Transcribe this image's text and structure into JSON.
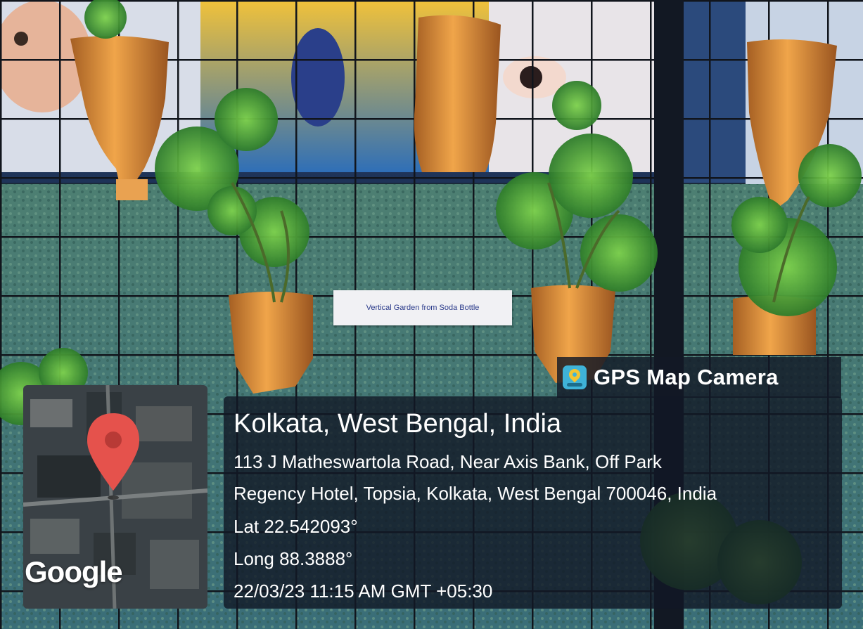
{
  "photo": {
    "description_icon": "vertical-garden-photo",
    "sign_text": "Vertical Garden from Soda Bottle"
  },
  "gps_overlay": {
    "app_name": "GPS Map Camera",
    "app_icon": "map-pin-icon",
    "location_title": "Kolkata, West Bengal, India",
    "address_line_1": "113 J Matheswartola Road, Near Axis Bank, Off Park",
    "address_line_2": "Regency Hotel, Topsia, Kolkata, West Bengal 700046, India",
    "latitude": "Lat 22.542093°",
    "longitude": "Long 88.3888°",
    "timestamp": "22/03/23 11:15 AM GMT +05:30",
    "map_brand": "Google",
    "map_marker_color": "#e5524c"
  }
}
